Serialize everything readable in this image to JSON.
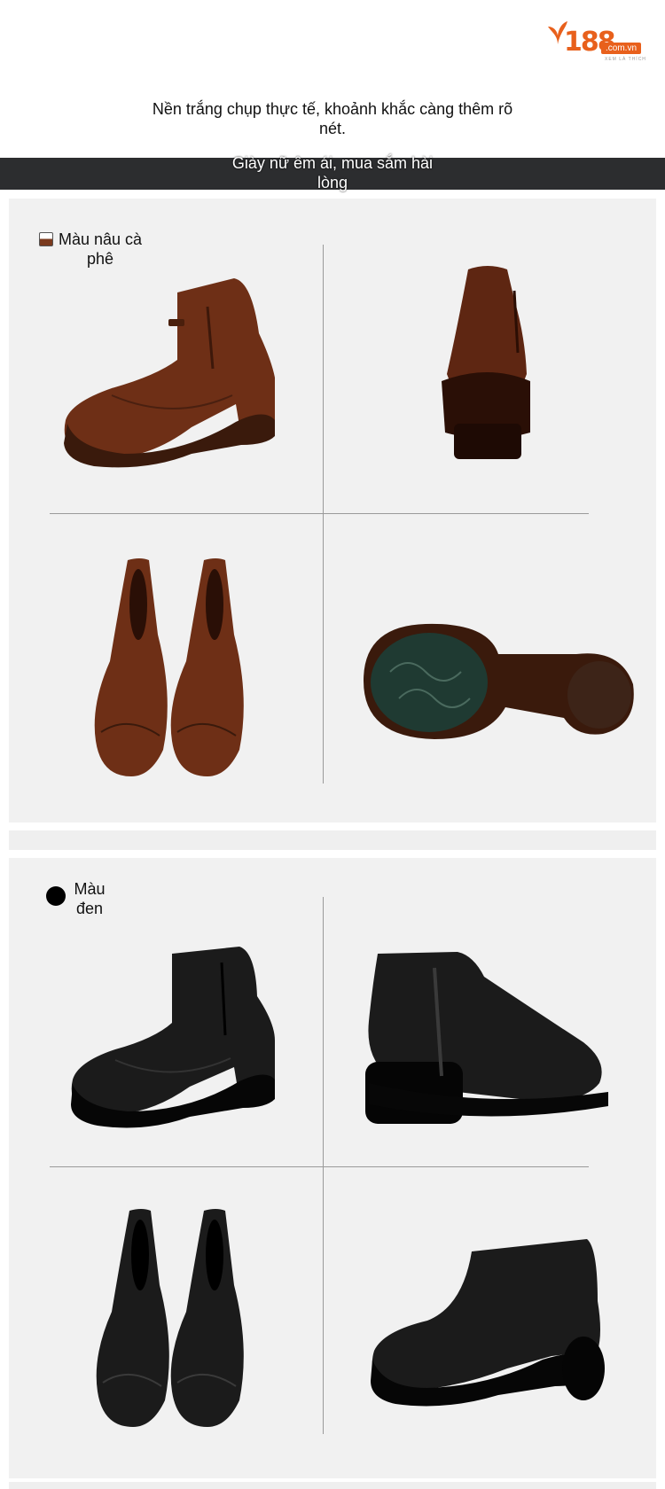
{
  "brand": {
    "logo_number": "188",
    "logo_domain": ".com.vn",
    "logo_tagline": "XEM LÀ THÍCH"
  },
  "headline": "Nền trắng chụp thực tế, khoảnh khắc càng thêm rõ nét.",
  "banner": "Giày nữ êm ái, mua sắm hài lòng",
  "sections": [
    {
      "label": "Màu nâu cà phê",
      "color": "#6e2f16",
      "swatch_icon": "brown-square-swatch-icon"
    },
    {
      "label": "Màu đen",
      "color": "#111111",
      "swatch_icon": "black-circle-swatch-icon"
    }
  ],
  "colors": {
    "banner_bg": "#2c2d2f",
    "panel_bg": "#f1f1f1",
    "logo_orange": "#e8601c"
  }
}
